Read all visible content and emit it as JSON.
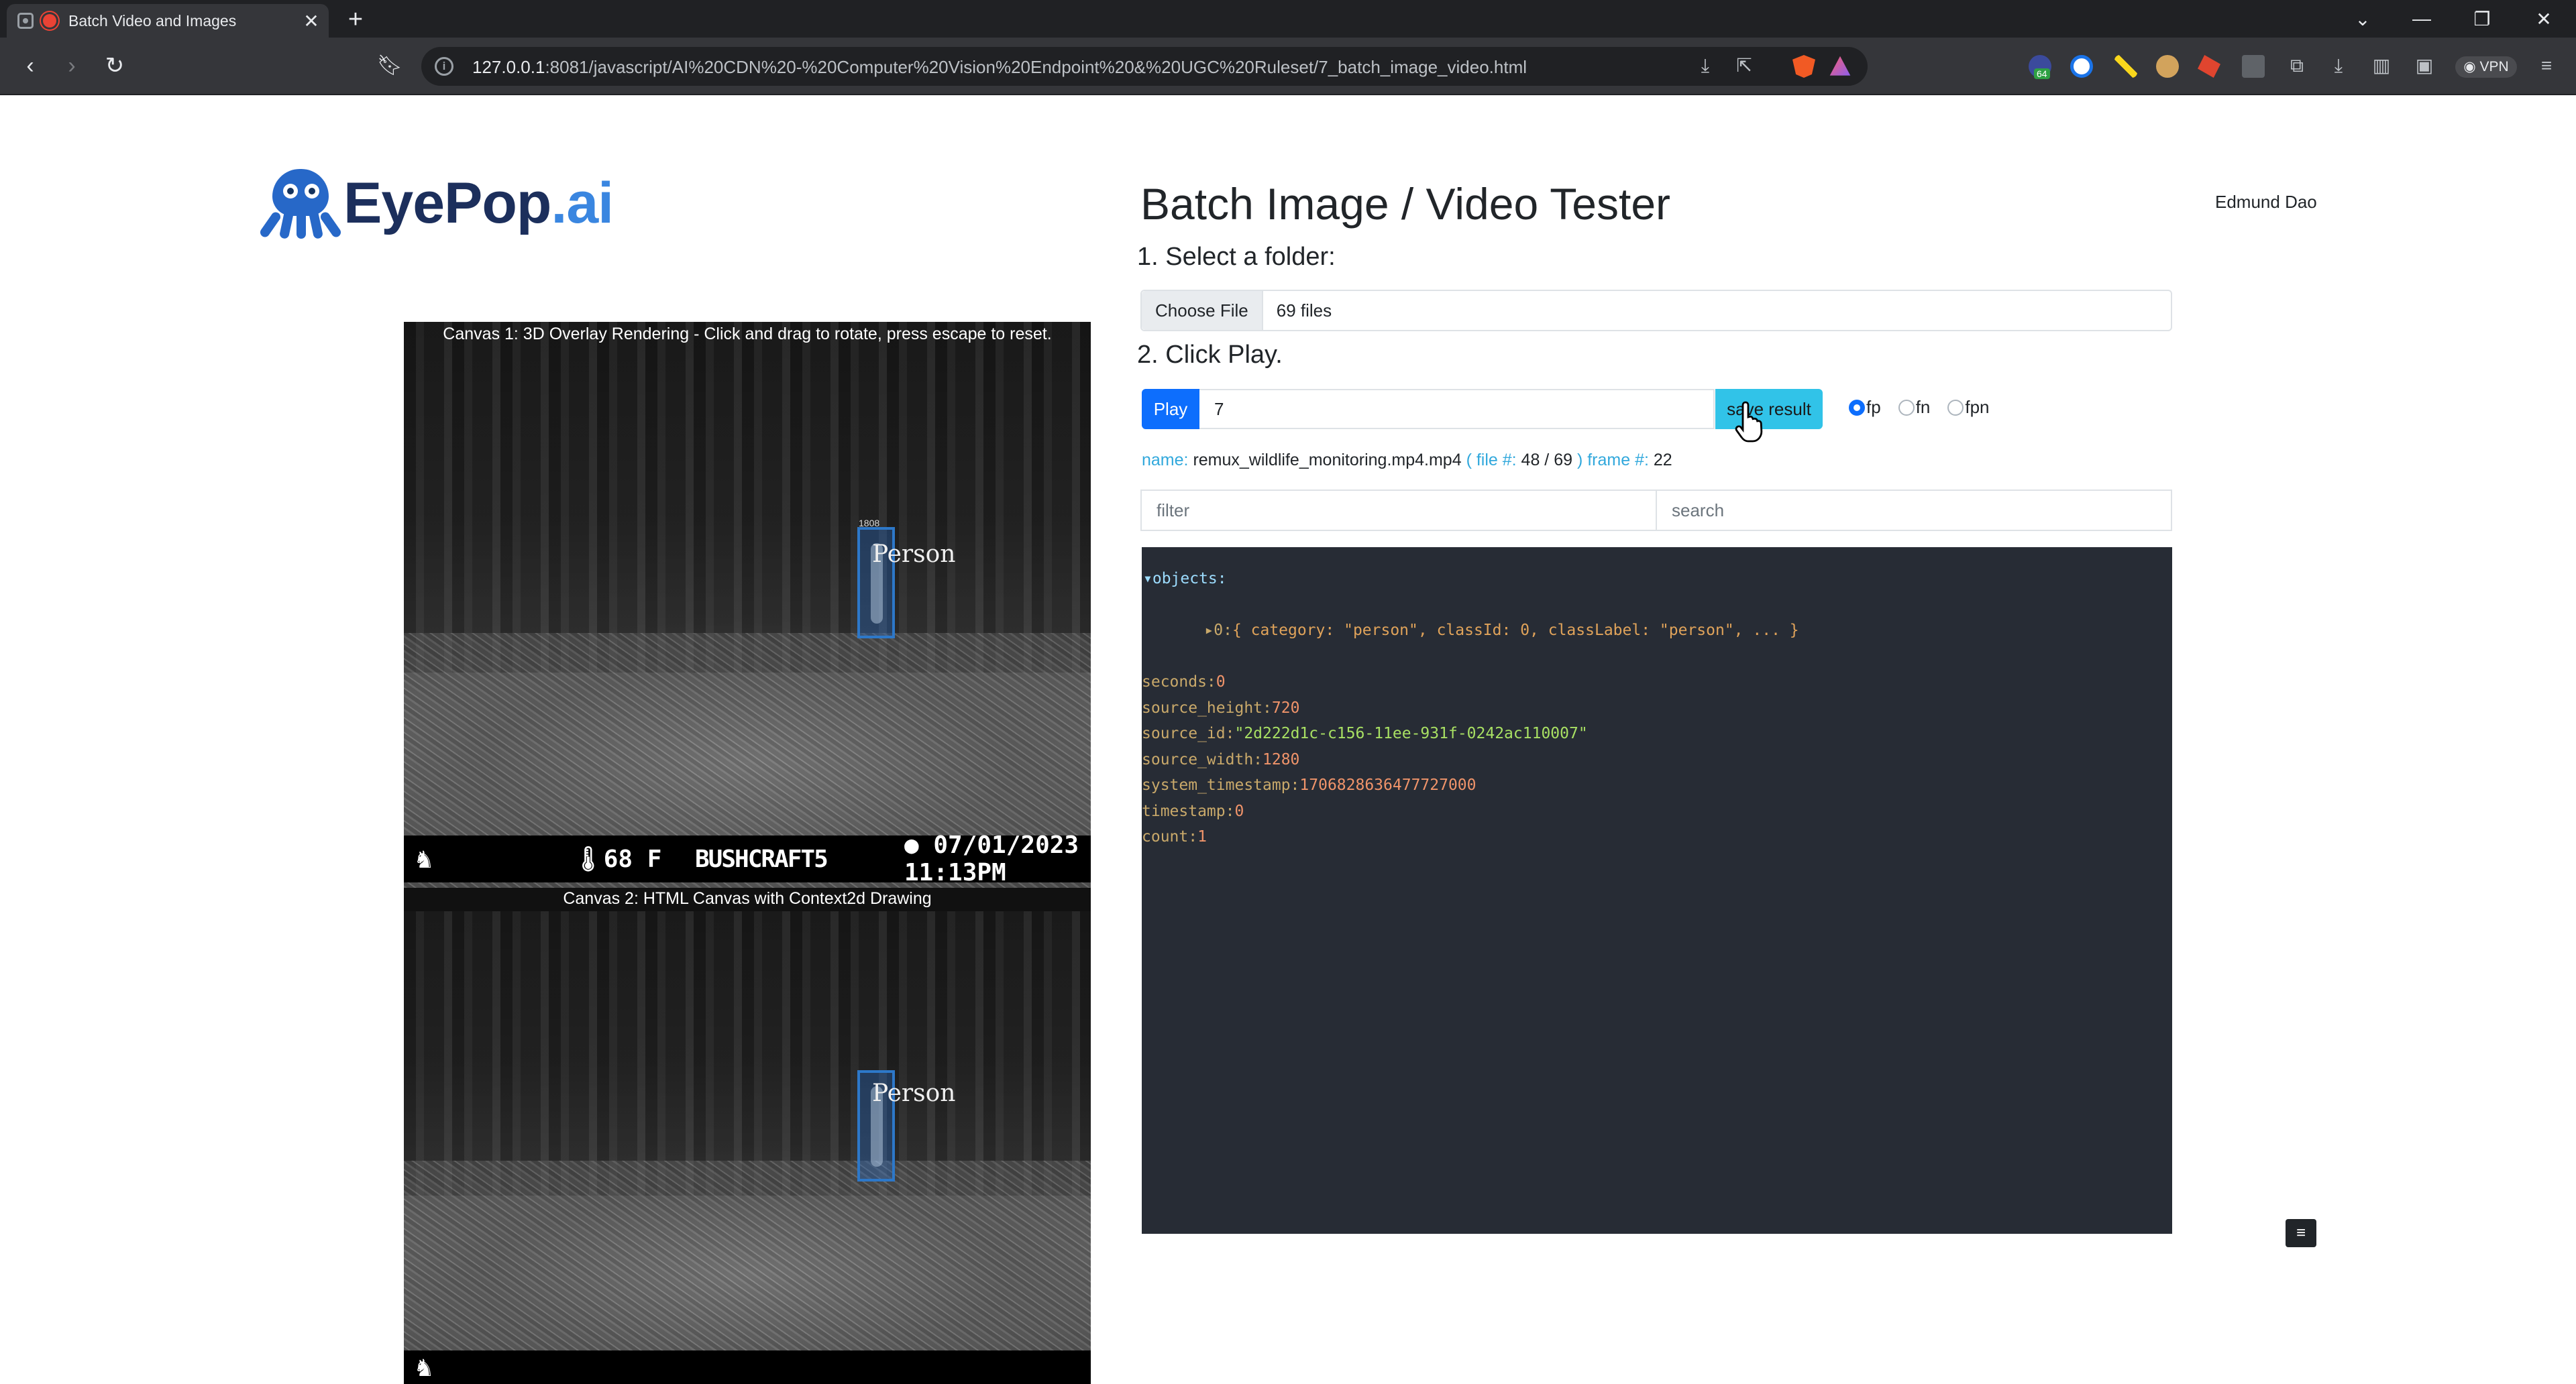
{
  "browser": {
    "tab_title": "Batch Video and Images",
    "tab_close": "✕",
    "new_tab": "+",
    "url_host": "127.0.0.1",
    "url_rest": ":8081/javascript/AI%20CDN%20-%20Computer%20Vision%20Endpoint%20&%20UGC%20Ruleset/7_batch_image_video.html",
    "info_glyph": "i",
    "vpn_label": "VPN",
    "ext_badge": "64"
  },
  "logo": {
    "word_main": "EyePop",
    "word_suffix": ".ai"
  },
  "page": {
    "title": "Batch Image / Video Tester",
    "user": "Edmund Dao",
    "step1": "1. Select a folder:",
    "step2": "2. Click Play.",
    "choose_file": "Choose File",
    "file_count": "69 files",
    "play": "Play",
    "number_value": "7",
    "save_result": "save result",
    "radios": [
      "fp",
      "fn",
      "fpn"
    ],
    "meta": {
      "name_key": "name:",
      "name_val": "remux_wildlife_monitoring.mp4.mp4",
      "file_key": "( file #:",
      "file_val": "48 / 69",
      "frame_key": ") frame #:",
      "frame_val": "22"
    },
    "filter_placeholder": "filter",
    "search_placeholder": "search",
    "scroll_button": "≡"
  },
  "json_view": {
    "objects_key": "▾objects:",
    "obj0_prefix": "▸0:",
    "obj0_summary": "{ category: \"person\", classId: 0, classLabel: \"person\", ... }",
    "rows": [
      {
        "key": "seconds:",
        "val": "0",
        "kind": "num"
      },
      {
        "key": "source_height:",
        "val": "720",
        "kind": "num"
      },
      {
        "key": "source_id:",
        "val": "\"2d222d1c-c156-11ee-931f-0242ac110007\"",
        "kind": "str"
      },
      {
        "key": "source_width:",
        "val": "1280",
        "kind": "num"
      },
      {
        "key": "system_timestamp:",
        "val": "1706828636477727000",
        "kind": "num"
      },
      {
        "key": "timestamp:",
        "val": "0",
        "kind": "num"
      },
      {
        "key": "count:",
        "val": "1",
        "kind": "num"
      }
    ]
  },
  "canvas1": {
    "caption": "Canvas 1: 3D Overlay Rendering - Click and drag to rotate, press escape to reset.",
    "label": "Person",
    "tiny_id": "1808",
    "temp": "🌡68 F",
    "brand": "BUSHCRAFT5",
    "datetime": "● 07/01/2023  11:13PM"
  },
  "canvas2": {
    "caption": "Canvas 2: HTML Canvas with Context2d Drawing",
    "label": "Person"
  },
  "colors": {
    "play": "#0d6efd",
    "save": "#31c3e8",
    "json_bg": "#272c35",
    "box": "#2d78c9"
  }
}
